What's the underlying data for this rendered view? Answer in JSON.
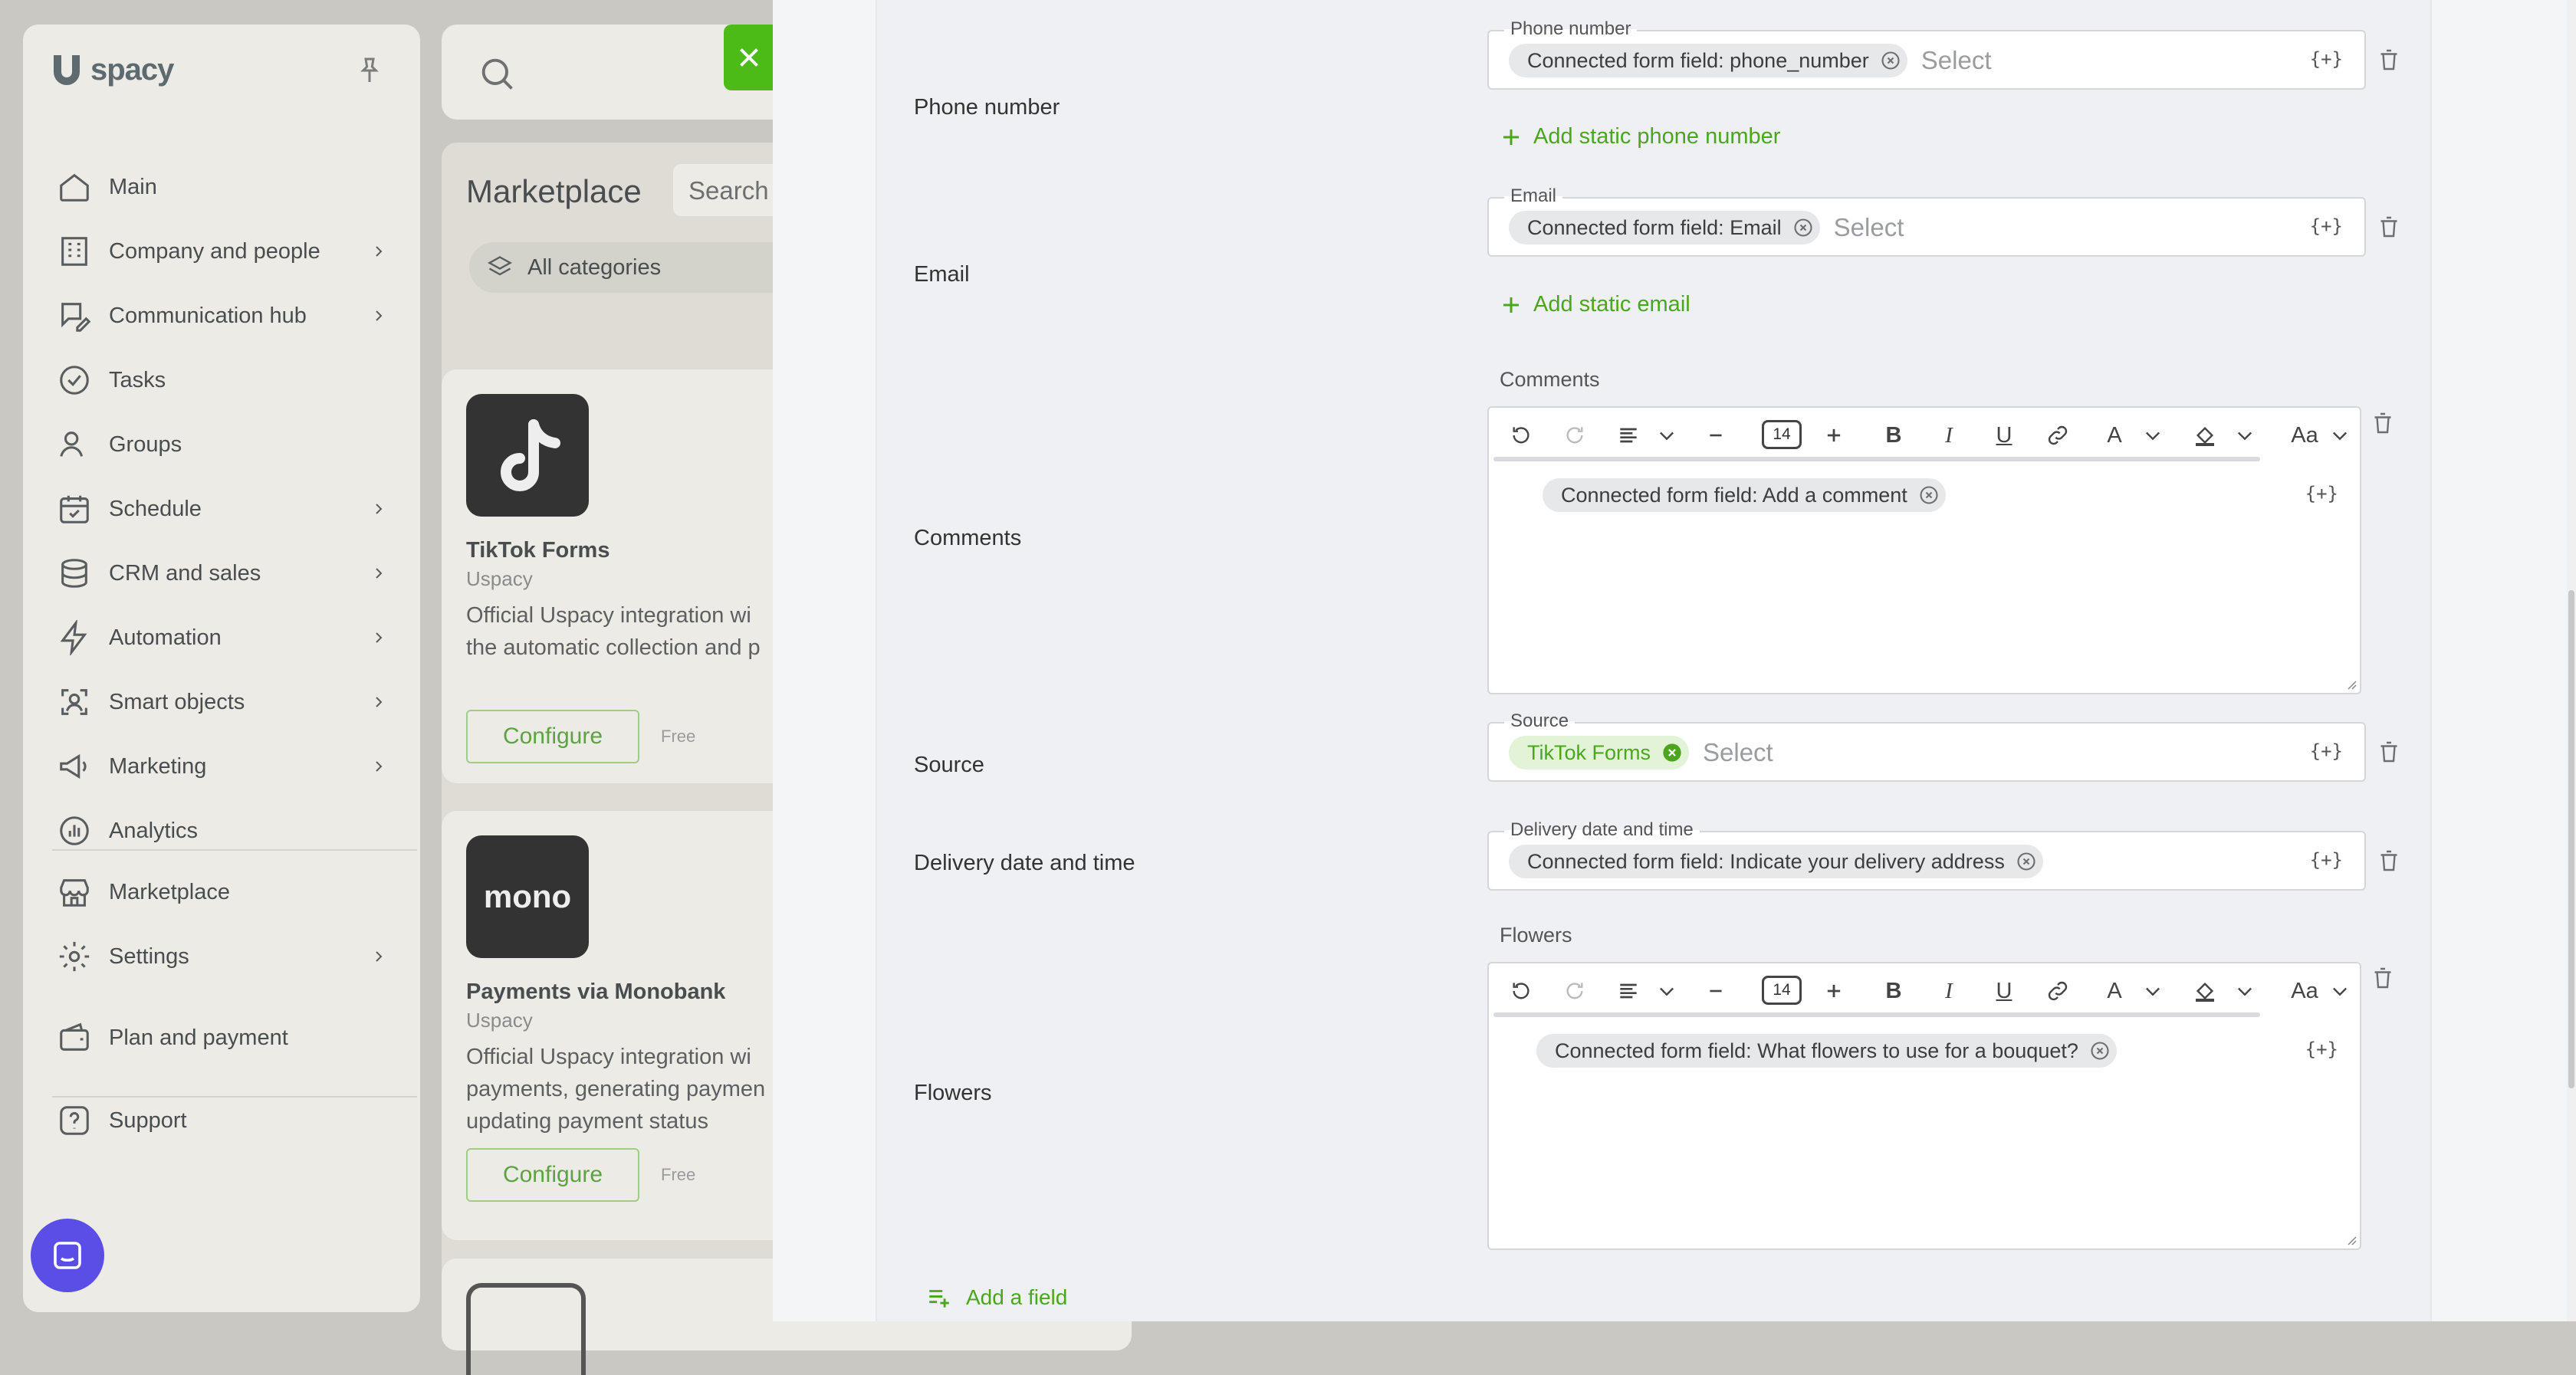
{
  "app": {
    "logo_text": "spacy",
    "sidebar": {
      "items": [
        {
          "label": "Main",
          "icon": "home-icon",
          "chevron": false
        },
        {
          "label": "Company and people",
          "icon": "building-icon",
          "chevron": true
        },
        {
          "label": "Communication hub",
          "icon": "chat-edit-icon",
          "chevron": true
        },
        {
          "label": "Tasks",
          "icon": "check-circle-icon",
          "chevron": false
        },
        {
          "label": "Groups",
          "icon": "users-icon",
          "chevron": false
        },
        {
          "label": "Schedule",
          "icon": "calendar-icon",
          "chevron": true
        },
        {
          "label": "CRM and sales",
          "icon": "coins-icon",
          "chevron": true
        },
        {
          "label": "Automation",
          "icon": "lightning-icon",
          "chevron": true
        },
        {
          "label": "Smart objects",
          "icon": "scan-icon",
          "chevron": true
        },
        {
          "label": "Marketing",
          "icon": "megaphone-icon",
          "chevron": true
        },
        {
          "label": "Analytics",
          "icon": "chart-icon",
          "chevron": false
        },
        {
          "label": "Marketplace",
          "icon": "store-icon",
          "chevron": false
        },
        {
          "label": "Settings",
          "icon": "gear-icon",
          "chevron": true
        },
        {
          "label": "Plan and payment",
          "icon": "wallet-icon",
          "chevron": false
        },
        {
          "label": "Support",
          "icon": "help-icon",
          "chevron": false
        }
      ]
    },
    "marketplace": {
      "title": "Marketplace",
      "search_placeholder": "Search",
      "category": "All categories",
      "cards": [
        {
          "name": "TikTok Forms",
          "vendor": "Uspacy",
          "desc_line1": "Official Uspacy integration wi",
          "desc_line2": "the automatic collection and p",
          "button": "Configure",
          "price": "Free",
          "thumb_text": ""
        },
        {
          "name": "Payments via Monobank",
          "vendor": "Uspacy",
          "desc_line1": "Official Uspacy integration wi",
          "desc_line2": "payments, generating paymen",
          "desc_line3": "updating payment status",
          "button": "Configure",
          "price": "Free",
          "thumb_text": "mono"
        }
      ]
    }
  },
  "form": {
    "phone": {
      "label": "Phone number",
      "legend": "Phone number",
      "chip": "Connected form field: phone_number",
      "placeholder": "Select",
      "add_link": "Add static phone number"
    },
    "email": {
      "label": "Email",
      "legend": "Email",
      "chip": "Connected form field: Email",
      "placeholder": "Select",
      "add_link": "Add static email"
    },
    "comments": {
      "label": "Comments",
      "editor_label": "Comments",
      "font_size": "14",
      "chip": "Connected form field: Add a comment"
    },
    "source": {
      "label": "Source",
      "legend": "Source",
      "chip": "TikTok Forms",
      "placeholder": "Select"
    },
    "delivery": {
      "label": "Delivery date and time",
      "legend": "Delivery date and time",
      "chip": "Connected form field: Indicate your delivery address"
    },
    "flowers": {
      "label": "Flowers",
      "editor_label": "Flowers",
      "font_size": "14",
      "chip": "Connected form field: What flowers to use for a bouquet?"
    },
    "variable_button": "{+}",
    "toolbar_text": {
      "bold": "B",
      "italic": "I",
      "underline": "U",
      "color": "A",
      "case": "Aa"
    },
    "add_field": "Add a field"
  },
  "colors": {
    "accent_green": "#4cbb17",
    "link_green": "#4aa71d",
    "chat_bubble": "#5b4ee6"
  }
}
